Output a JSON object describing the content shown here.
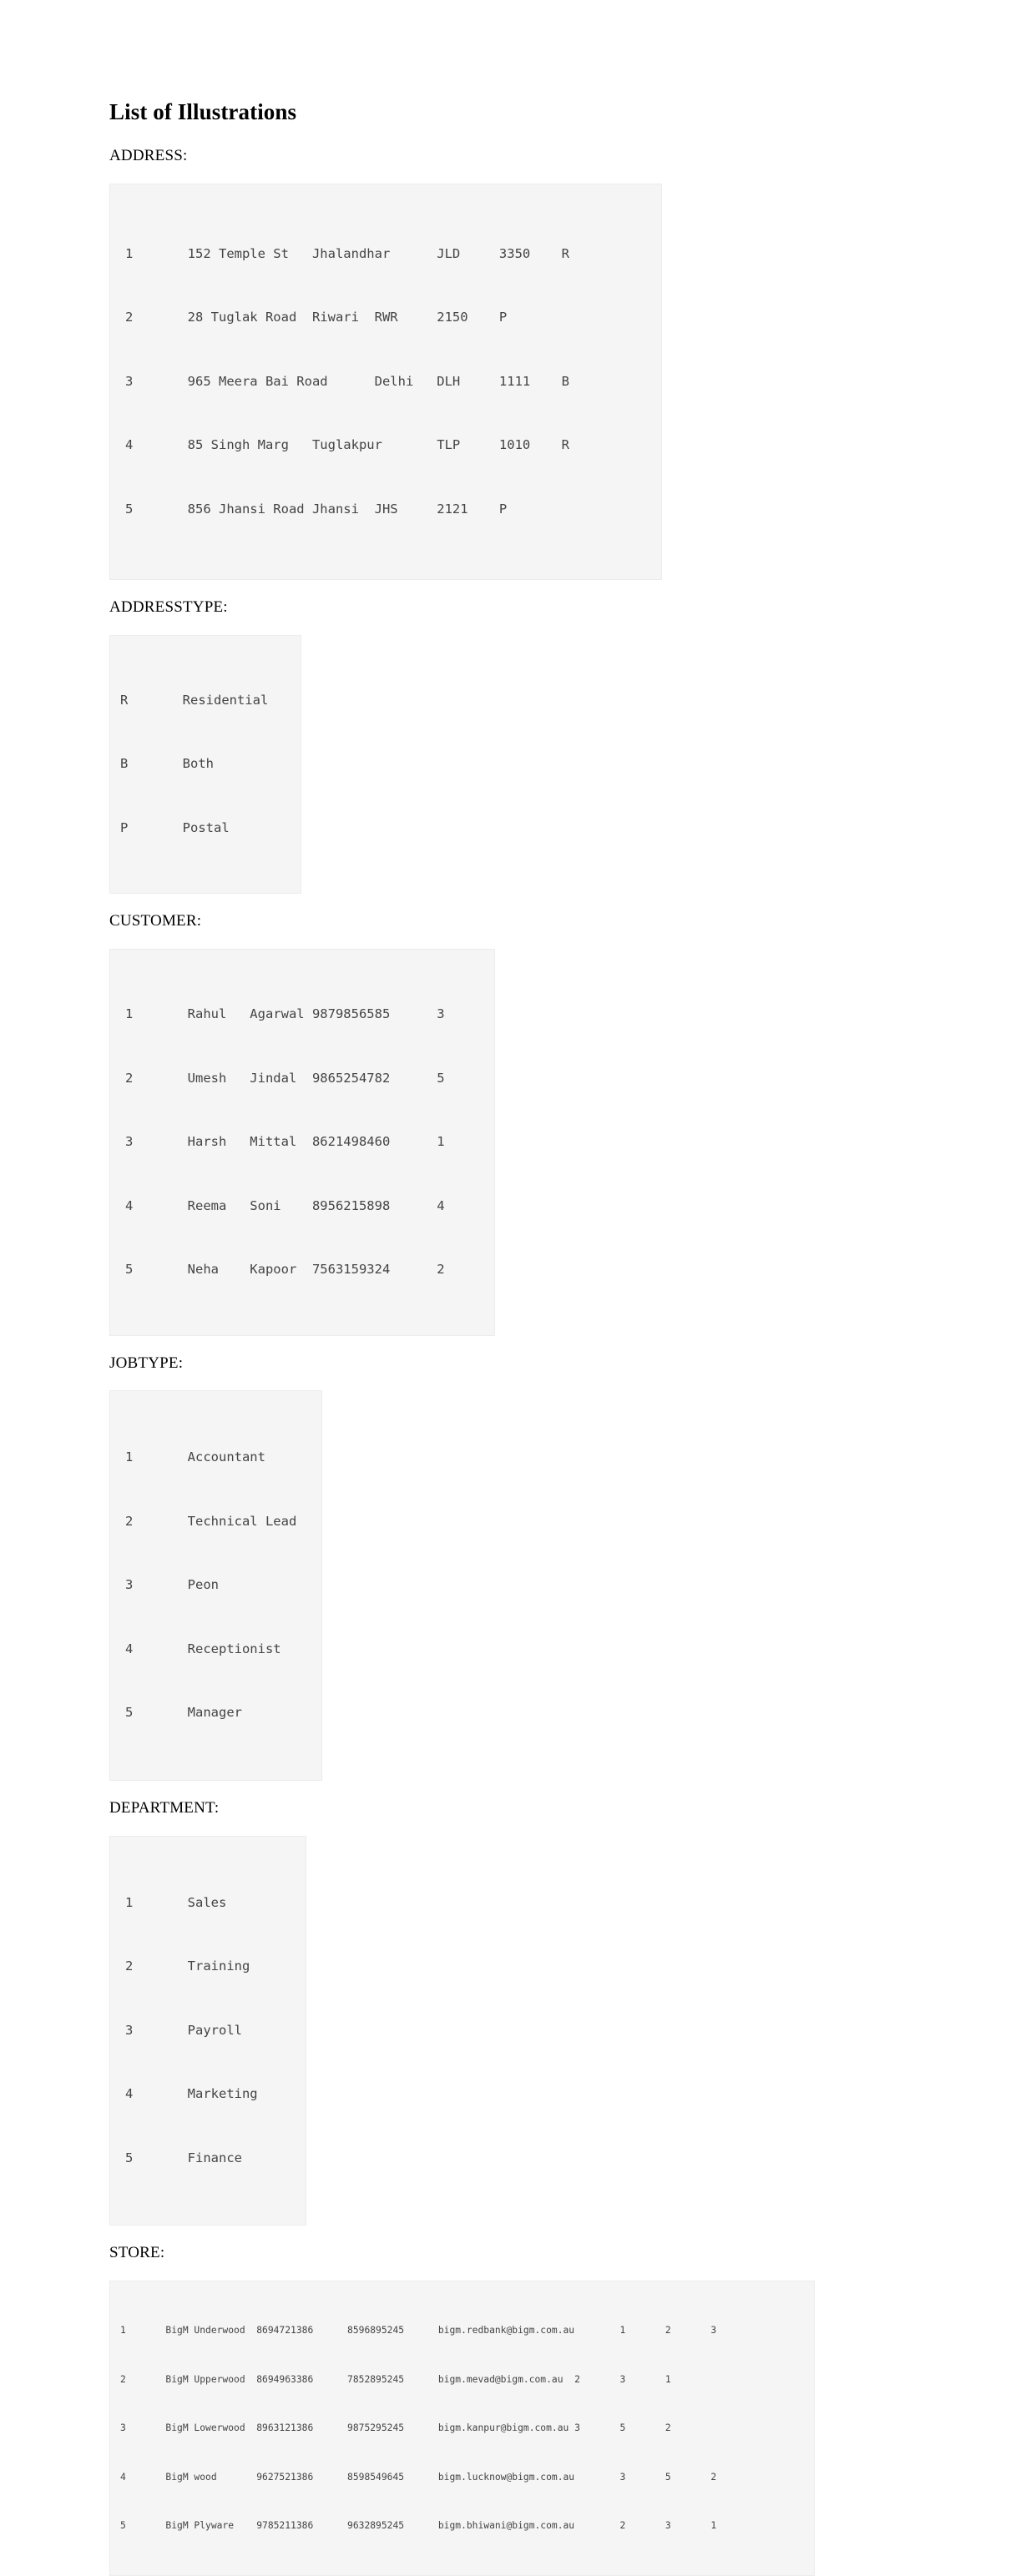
{
  "document": {
    "title": "List of Illustrations"
  },
  "sections": [
    {
      "id": "address",
      "label": "ADDRESS:",
      "rows": [
        "1       152 Temple St   Jhalandhar      JLD     3350    R",
        "2       28 Tuglak Road  Riwari  RWR     2150    P",
        "3       965 Meera Bai Road      Delhi   DLH     1111    B",
        "4       85 Singh Marg   Tuglakpur       TLP     1010    R",
        "5       856 Jhansi Road Jhansi  JHS     2121    P"
      ]
    },
    {
      "id": "addresstype",
      "label": "ADDRESSTYPE:",
      "rows": [
        "R       Residential",
        "B       Both",
        "P       Postal"
      ]
    },
    {
      "id": "customer",
      "label": "CUSTOMER:",
      "rows": [
        "1       Rahul   Agarwal 9879856585      3",
        "2       Umesh   Jindal  9865254782      5",
        "3       Harsh   Mittal  8621498460      1",
        "4       Reema   Soni    8956215898      4",
        "5       Neha    Kapoor  7563159324      2"
      ]
    },
    {
      "id": "jobtype",
      "label": "JOBTYPE:",
      "rows": [
        "1       Accountant",
        "2       Technical Lead",
        "3       Peon",
        "4       Receptionist",
        "5       Manager"
      ]
    },
    {
      "id": "department",
      "label": "DEPARTMENT:",
      "rows": [
        "1       Sales",
        "2       Training",
        "3       Payroll",
        "4       Marketing",
        "5       Finance"
      ]
    },
    {
      "id": "store",
      "label": "STORE:",
      "rows": [
        "1       BigM Underwood  8694721386      8596895245      bigm.redbank@bigm.com.au        1       2       3",
        "2       BigM Upperwood  8694963386      7852895245      bigm.mevad@bigm.com.au  2       3       1",
        "3       BigM Lowerwood  8963121386      9875295245      bigm.kanpur@bigm.com.au 3       5       2",
        "4       BigM wood       9627521386      8598549645      bigm.lucknow@bigm.com.au        3       5       2",
        "5       BigM Plyware    9785211386      9632895245      bigm.bhiwani@bigm.com.au        2       3       1"
      ]
    }
  ]
}
